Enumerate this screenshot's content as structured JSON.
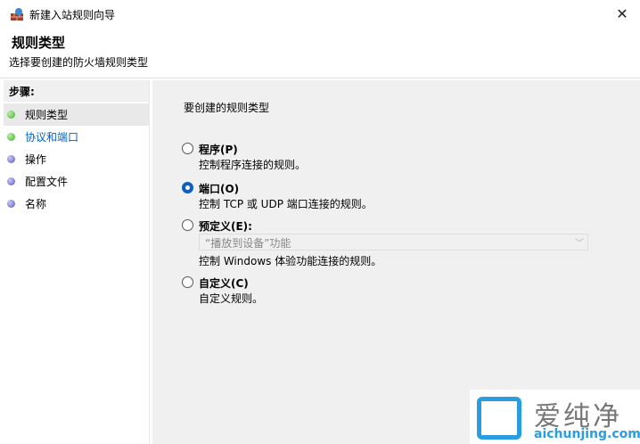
{
  "window": {
    "title": "新建入站规则向导",
    "close": "✕"
  },
  "header": {
    "title": "规则类型",
    "subtitle": "选择要创建的防火墙规则类型"
  },
  "steps": {
    "heading": "步骤:",
    "items": [
      {
        "label": "规则类型"
      },
      {
        "label": "协议和端口"
      },
      {
        "label": "操作"
      },
      {
        "label": "配置文件"
      },
      {
        "label": "名称"
      }
    ]
  },
  "main": {
    "question": "要创建的规则类型",
    "options": [
      {
        "label": "程序(P)",
        "desc": "控制程序连接的规则。",
        "selected": false
      },
      {
        "label": "端口(O)",
        "desc": "控制 TCP 或 UDP 端口连接的规则。",
        "selected": true
      },
      {
        "label": "预定义(E):",
        "desc": "控制 Windows 体验功能连接的规则。",
        "selected": false
      },
      {
        "label": "自定义(C)",
        "desc": "自定义规则。",
        "selected": false
      }
    ],
    "predefined_value": "“播放到设备”功能"
  },
  "watermark": {
    "cn": "爱纯净",
    "en": "aichunjing.com"
  }
}
